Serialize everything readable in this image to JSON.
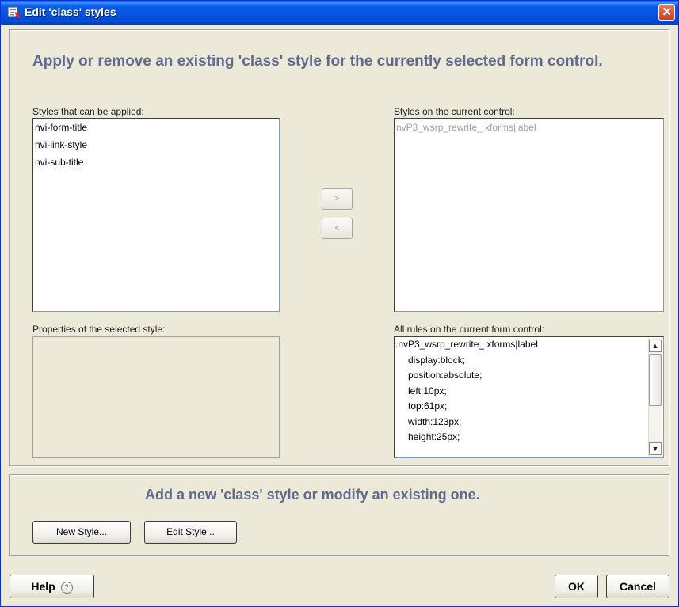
{
  "window": {
    "title": "Edit 'class' styles",
    "close_glyph": "✕"
  },
  "top_panel": {
    "heading": "Apply or remove an existing 'class' style for the currently selected form control.",
    "available_label": "Styles that can be applied:",
    "available_items": [
      "nvi-form-title",
      "nvi-link-style",
      "nvi-sub-title"
    ],
    "current_label": "Styles on the current control:",
    "current_items": [
      "nvP3_wsrp_rewrite_ xforms|label"
    ],
    "add_glyph": ">",
    "remove_glyph": "<",
    "properties_label": "Properties of the selected style:",
    "rules_label": "All rules on the current form control:",
    "rules_items": [
      ".nvP3_wsrp_rewrite_ xforms|label",
      "display:block;",
      "position:absolute;",
      "left:10px;",
      "top:61px;",
      "width:123px;",
      "height:25px;"
    ],
    "scroll_up_glyph": "▲",
    "scroll_down_glyph": "▼"
  },
  "bottom_panel": {
    "heading": "Add a new 'class' style or modify an existing one.",
    "new_style_label": "New Style...",
    "edit_style_label": "Edit Style..."
  },
  "footer": {
    "help_label": "Help",
    "help_icon_glyph": "?",
    "ok_label": "OK",
    "cancel_label": "Cancel"
  }
}
